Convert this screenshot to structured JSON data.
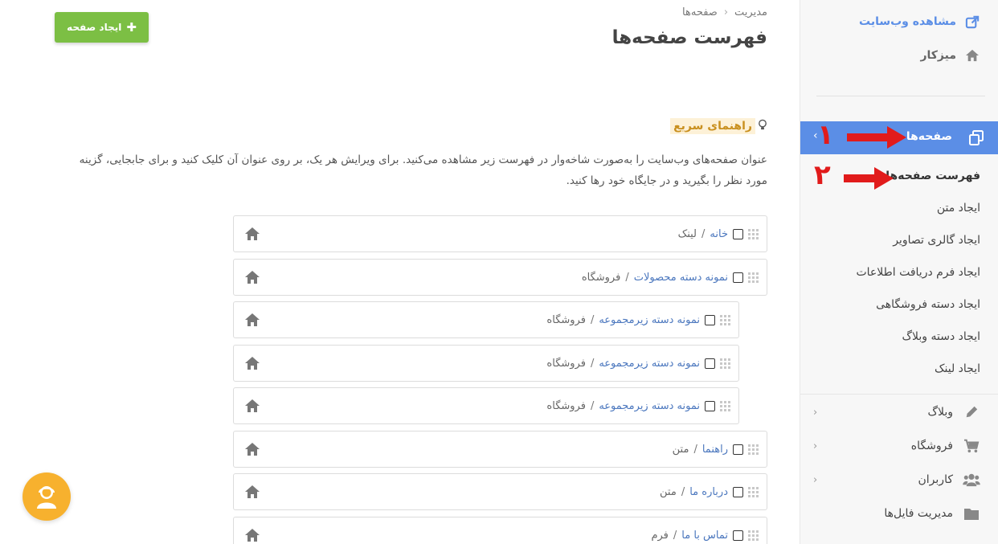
{
  "breadcrumb": {
    "root": "مدیریت",
    "current": "صفحه‌ها"
  },
  "page_title": "فهرست صفحه‌ها",
  "create_button": "ایجاد صفحه",
  "guide": {
    "title": "راهنمای سریع",
    "text": "عنوان صفحه‌های وب‌سایت را به‌صورت شاخه‌وار در فهرست زیر مشاهده می‌کنید. برای ویرایش هر یک، بر روی عنوان آن کلیک کنید و برای جابجایی، گزینه مورد نظر را بگیرید و در جایگاه خود رها کنید."
  },
  "sidebar": {
    "view_site": "مشاهده وب‌سایت",
    "dashboard": "میزکار",
    "pages": "صفحه‌ها",
    "sub_items": [
      "فهرست صفحه‌ها",
      "ایجاد متن",
      "ایجاد گالری تصاویر",
      "ایجاد فرم دریافت اطلاعات",
      "ایجاد دسته فروشگاهی",
      "ایجاد دسته وبلاگ",
      "ایجاد لینک"
    ],
    "menus": [
      "وبلاگ",
      "فروشگاه",
      "کاربران",
      "مدیریت فایل‌ها"
    ]
  },
  "annotations": {
    "one": "۱",
    "two": "۲"
  },
  "rows": [
    {
      "title": "خانه",
      "type": "لینک"
    },
    {
      "title": "نمونه دسته محصولات",
      "type": "فروشگاه"
    },
    {
      "title": "نمونه دسته زیرمجموعه",
      "type": "فروشگاه"
    },
    {
      "title": "نمونه دسته زیرمجموعه",
      "type": "فروشگاه"
    },
    {
      "title": "نمونه دسته زیرمجموعه",
      "type": "فروشگاه"
    },
    {
      "title": "راهنما",
      "type": "متن"
    },
    {
      "title": "درباره ما",
      "type": "متن"
    },
    {
      "title": "تماس با ما",
      "type": "فرم"
    }
  ],
  "colors": {
    "accent": "#5b8ee6",
    "create": "#7cbf44",
    "link": "#4b77be",
    "annotation": "#e11b1b",
    "support": "#f7b12e"
  }
}
